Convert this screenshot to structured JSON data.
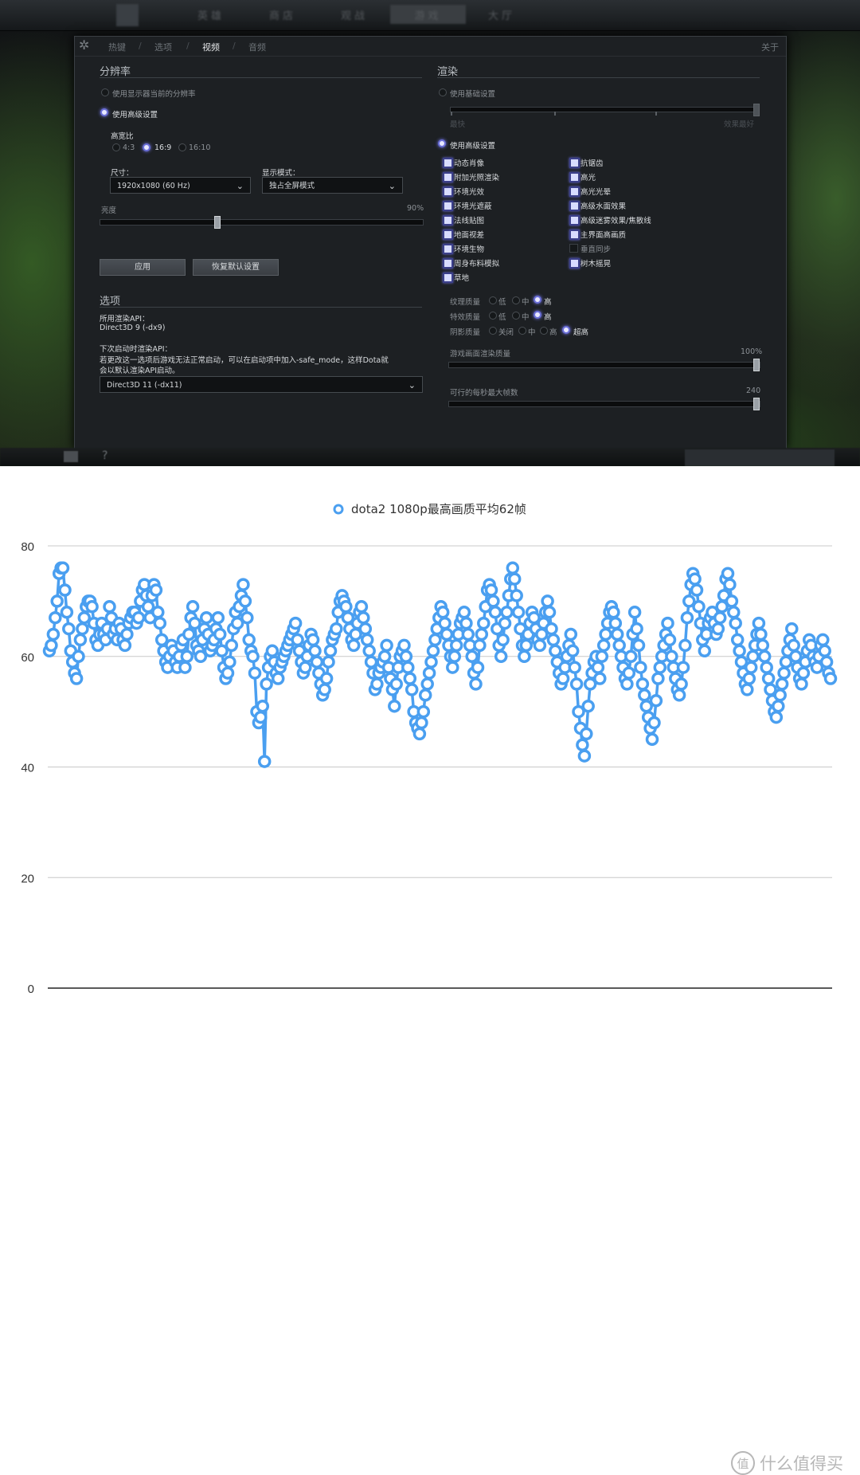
{
  "game": {
    "topnav": [
      "英雄",
      "商店",
      "观战",
      "游戏",
      "大厅"
    ],
    "tabs": [
      {
        "label": "热键",
        "active": false
      },
      {
        "label": "选项",
        "active": false
      },
      {
        "label": "视频",
        "active": true
      },
      {
        "label": "音频",
        "active": false
      }
    ],
    "about_label": "关于",
    "resolution": {
      "title": "分辨率",
      "use_current": "使用显示器当前的分辨率",
      "use_advanced": "使用高级设置",
      "aspect_label": "高宽比",
      "aspect_options": [
        "4:3",
        "16:9",
        "16:10"
      ],
      "aspect_selected": "16:9",
      "size_label": "尺寸：",
      "size_value": "1920x1080 (60 Hz)",
      "display_mode_label": "显示模式：",
      "display_mode_value": "独占全屏模式",
      "brightness_label": "亮度",
      "brightness_value_text": "90%",
      "brightness_level": 0.9,
      "apply_button": "应用",
      "restore_button": "恢复默认设置"
    },
    "options": {
      "title": "选项",
      "api_label": "所用渲染API：",
      "api_value": "Direct3D 9 (-dx9)",
      "next_api_label": "下次启动时渲染API：",
      "next_api_note_1": "若更改这一选项后游戏无法正常启动，可以在启动项中加入-safe_mode，这样Dota就",
      "next_api_note_2": "会以默认渲染API启动。",
      "api_select_value": "Direct3D 11 (-dx11)"
    },
    "render": {
      "title": "渲染",
      "use_basic": "使用基础设置",
      "basic_left": "最快",
      "basic_right": "效果最好",
      "use_advanced": "使用高级设置",
      "checkboxes_left": [
        {
          "label": "动态肖像",
          "checked": true
        },
        {
          "label": "附加光照渲染",
          "checked": true
        },
        {
          "label": "环境光效",
          "checked": true
        },
        {
          "label": "环境光遮蔽",
          "checked": true
        },
        {
          "label": "法线贴图",
          "checked": true
        },
        {
          "label": "地面视差",
          "checked": true
        },
        {
          "label": "环境生物",
          "checked": true
        },
        {
          "label": "周身布料模拟",
          "checked": true
        },
        {
          "label": "草地",
          "checked": true
        }
      ],
      "checkboxes_right": [
        {
          "label": "抗锯齿",
          "checked": true
        },
        {
          "label": "高光",
          "checked": true
        },
        {
          "label": "高光光晕",
          "checked": true
        },
        {
          "label": "高级水面效果",
          "checked": true
        },
        {
          "label": "高级迷雾效果/焦散线",
          "checked": true
        },
        {
          "label": "主界面高画质",
          "checked": true
        },
        {
          "label": "垂直同步",
          "checked": false
        },
        {
          "label": "树木摇晃",
          "checked": true
        }
      ],
      "texture_label": "纹理质量",
      "effect_label": "特效质量",
      "shadow_label": "阴影质量",
      "q_low": "低",
      "q_mid": "中",
      "q_high": "高",
      "q_off": "关闭",
      "q_ultra": "超高",
      "texture_selected": "高",
      "effect_selected": "高",
      "shadow_selected": "超高",
      "render_quality_label": "游戏画面渲染质量",
      "render_quality_value": "100%",
      "render_quality_level": 1.0,
      "max_fps_label": "可行的每秒最大帧数",
      "max_fps_value": "240",
      "max_fps_level": 1.0
    }
  },
  "chart_data": {
    "type": "line",
    "legend_position": "top-center",
    "grid": true,
    "ylim": [
      0,
      80
    ],
    "yticks": [
      "0",
      "20",
      "40",
      "60",
      "80"
    ],
    "series": [
      {
        "name": "dota2 1080p最高画质平均62帧",
        "color": "#4a9ff0",
        "values": [
          61,
          62,
          64,
          67,
          70,
          75,
          76,
          76,
          72,
          68,
          65,
          61,
          59,
          57,
          56,
          60,
          63,
          65,
          67,
          69,
          70,
          70,
          69,
          66,
          63,
          62,
          64,
          66,
          64,
          63,
          65,
          69,
          67,
          64,
          65,
          63,
          66,
          65,
          63,
          62,
          64,
          66,
          67,
          68,
          68,
          66,
          67,
          70,
          72,
          73,
          71,
          69,
          67,
          71,
          73,
          72,
          68,
          66,
          63,
          61,
          59,
          58,
          60,
          62,
          61,
          59,
          58,
          60,
          62,
          63,
          58,
          60,
          64,
          67,
          69,
          66,
          62,
          61,
          60,
          63,
          65,
          67,
          64,
          61,
          62,
          63,
          65,
          67,
          64,
          61,
          58,
          56,
          57,
          59,
          62,
          65,
          68,
          66,
          69,
          71,
          73,
          70,
          67,
          63,
          61,
          60,
          57,
          50,
          48,
          49,
          51,
          41,
          55,
          58,
          60,
          61,
          59,
          57,
          56,
          58,
          59,
          60,
          61,
          62,
          63,
          64,
          65,
          66,
          63,
          61,
          59,
          57,
          58,
          60,
          62,
          64,
          63,
          61,
          59,
          57,
          55,
          53,
          54,
          56,
          59,
          61,
          63,
          64,
          65,
          68,
          70,
          71,
          70,
          69,
          67,
          65,
          63,
          62,
          64,
          66,
          68,
          69,
          67,
          65,
          63,
          61,
          59,
          57,
          54,
          55,
          57,
          58,
          59,
          60,
          62,
          58,
          56,
          54,
          51,
          55,
          58,
          60,
          61,
          62,
          60,
          58,
          56,
          54,
          50,
          48,
          47,
          46,
          48,
          50,
          53,
          55,
          57,
          59,
          61,
          63,
          65,
          67,
          69,
          68,
          66,
          64,
          62,
          60,
          58,
          60,
          62,
          64,
          66,
          67,
          68,
          66,
          64,
          62,
          60,
          57,
          55,
          58,
          62,
          64,
          66,
          69,
          72,
          73,
          72,
          70,
          68,
          65,
          62,
          60,
          63,
          66,
          68,
          71,
          74,
          76,
          74,
          71,
          68,
          65,
          62,
          60,
          62,
          64,
          66,
          68,
          67,
          65,
          63,
          62,
          64,
          66,
          68,
          70,
          68,
          65,
          63,
          61,
          59,
          57,
          55,
          56,
          58,
          60,
          62,
          64,
          61,
          58,
          55,
          50,
          47,
          44,
          42,
          46,
          51,
          55,
          57,
          59,
          60,
          58,
          56,
          60,
          62,
          64,
          66,
          68,
          69,
          68,
          66,
          64,
          62,
          60,
          58,
          56,
          55,
          57,
          60,
          64,
          68,
          65,
          62,
          58,
          55,
          53,
          51,
          49,
          47,
          45,
          48,
          52,
          56,
          58,
          60,
          62,
          64,
          66,
          63,
          60,
          58,
          56,
          54,
          53,
          55,
          58,
          62,
          67,
          70,
          73,
          75,
          74,
          72,
          69,
          66,
          63,
          61,
          64,
          66,
          67,
          68,
          66,
          64,
          65,
          67,
          69,
          71,
          74,
          75,
          73,
          70,
          68,
          66,
          63,
          61,
          59,
          57,
          55,
          54,
          56,
          58,
          60,
          62,
          64,
          66,
          64,
          62,
          60,
          58,
          56,
          54,
          52,
          50,
          49,
          51,
          53,
          55,
          57,
          59,
          61,
          63,
          65,
          62,
          60,
          58,
          56,
          55,
          57,
          59,
          61,
          63,
          62,
          60,
          59,
          58,
          60,
          62,
          63,
          61,
          59,
          57,
          56
        ]
      }
    ]
  },
  "watermark": {
    "glyph": "值",
    "text": "什么值得买"
  }
}
